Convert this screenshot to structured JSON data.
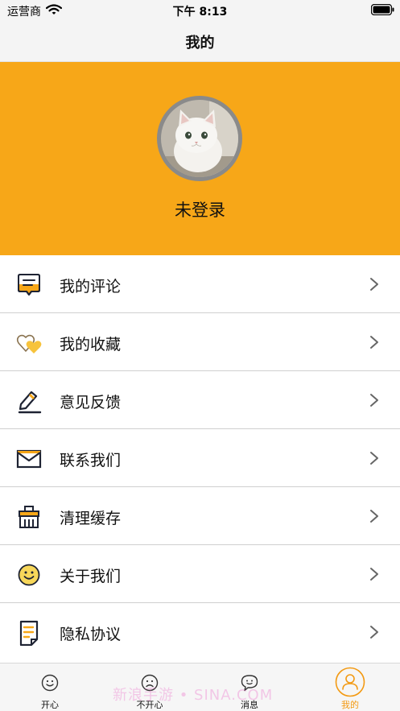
{
  "status_bar": {
    "carrier": "运营商",
    "time": "下午 8:13"
  },
  "nav": {
    "title": "我的"
  },
  "profile": {
    "login_status": "未登录",
    "header_color": "#f7a718"
  },
  "menu": {
    "items": [
      {
        "label": "我的评论",
        "icon": "comment-icon"
      },
      {
        "label": "我的收藏",
        "icon": "hearts-icon"
      },
      {
        "label": "意见反馈",
        "icon": "pencil-icon"
      },
      {
        "label": "联系我们",
        "icon": "envelope-icon"
      },
      {
        "label": "清理缓存",
        "icon": "cache-icon"
      },
      {
        "label": "关于我们",
        "icon": "smiley-icon"
      },
      {
        "label": "隐私协议",
        "icon": "document-icon"
      }
    ]
  },
  "tab_bar": {
    "active_color": "#f39a13",
    "tabs": [
      {
        "label": "开心",
        "icon": "happy-face-icon",
        "active": false
      },
      {
        "label": "不开心",
        "icon": "sad-face-icon",
        "active": false
      },
      {
        "label": "消息",
        "icon": "chat-bubble-icon",
        "active": false
      },
      {
        "label": "我的",
        "icon": "person-icon",
        "active": true
      }
    ],
    "watermark": "新浪手游 • SINA.COM"
  }
}
